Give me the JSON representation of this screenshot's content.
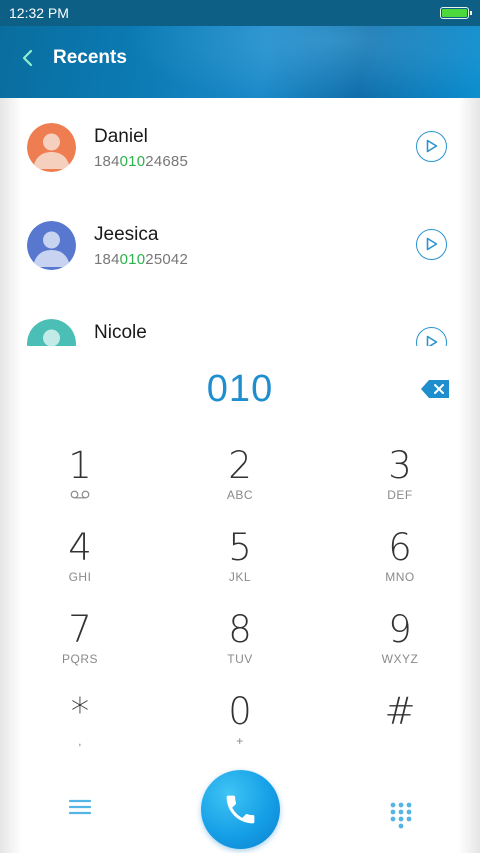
{
  "status_bar": {
    "time": "12:32 PM",
    "battery_icon": "battery-full-icon"
  },
  "app_bar": {
    "title": "Recents",
    "back_icon": "back-arrow-icon"
  },
  "recents": [
    {
      "name": "Daniel",
      "number_prefix": "184",
      "number_match": "010",
      "number_suffix": "24685",
      "avatar_color": "#ee7e52",
      "avatar_bg": "#f6d0bf"
    },
    {
      "name": "Jeesica",
      "number_prefix": "184",
      "number_match": "010",
      "number_suffix": "25042",
      "avatar_color": "#5877cf",
      "avatar_bg": "#c8d3f1"
    },
    {
      "name": "Nicole",
      "number_prefix": "",
      "number_match": "",
      "number_suffix": "",
      "avatar_color": "#4bbfb5",
      "avatar_bg": "#c2ebe7"
    }
  ],
  "dialer": {
    "input": "010"
  },
  "keys": [
    {
      "digit": "1",
      "letters": ""
    },
    {
      "digit": "2",
      "letters": "ABC"
    },
    {
      "digit": "3",
      "letters": "DEF"
    },
    {
      "digit": "4",
      "letters": "GHI"
    },
    {
      "digit": "5",
      "letters": "JKL"
    },
    {
      "digit": "6",
      "letters": "MNO"
    },
    {
      "digit": "7",
      "letters": "PQRS"
    },
    {
      "digit": "8",
      "letters": "TUV"
    },
    {
      "digit": "9",
      "letters": "WXYZ"
    },
    {
      "digit": "*",
      "letters": ","
    },
    {
      "digit": "0",
      "letters": "+"
    },
    {
      "digit": "#",
      "letters": ""
    }
  ],
  "colors": {
    "accent": "#1e8ecf",
    "match": "#2bb34a",
    "app_bar": "#0b7bb4"
  }
}
